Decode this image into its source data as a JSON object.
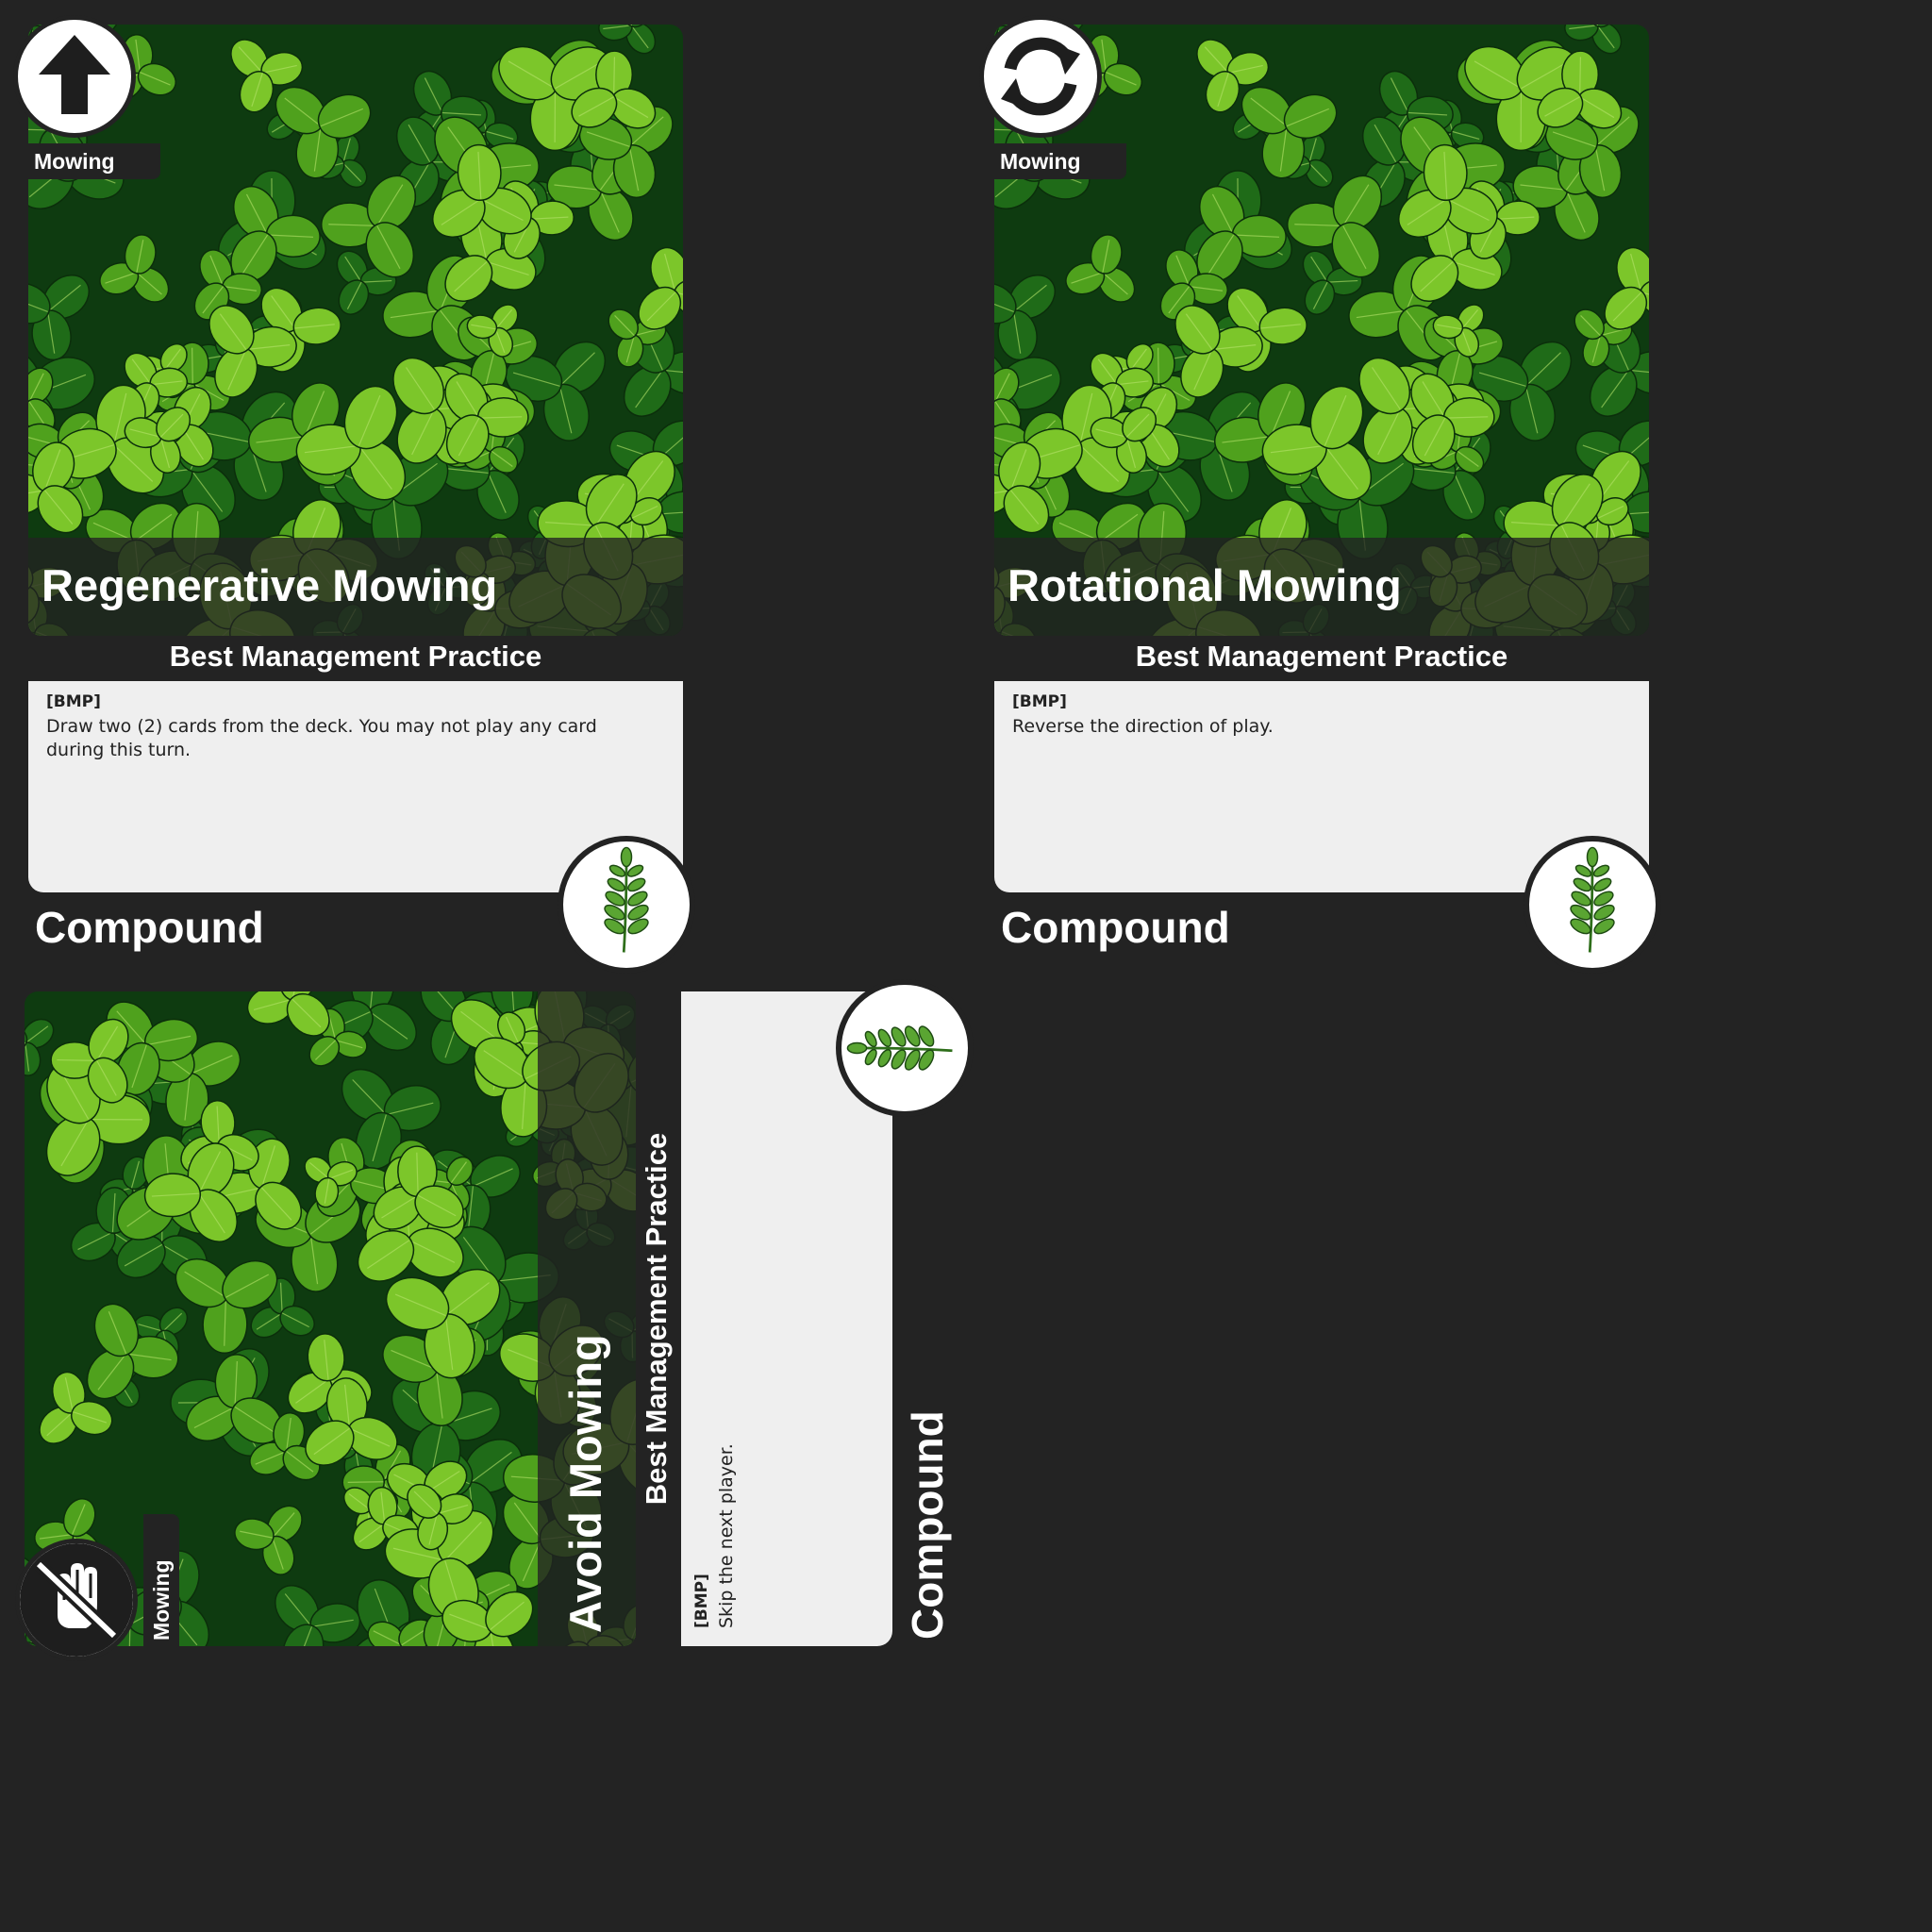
{
  "cards": [
    {
      "title": "Regenerative Mowing",
      "subtitle": "Best Management Practice",
      "category": "Mowing",
      "tag": "[BMP]",
      "body": "Draw two (2) cards from the deck. You may not play any card during this turn.",
      "footer": "Compound",
      "icon": "arrow-up-icon",
      "badge_icon": "leaf-sprig-icon"
    },
    {
      "title": "Rotational Mowing",
      "subtitle": "Best Management Practice",
      "category": "Mowing",
      "tag": "[BMP]",
      "body": "Reverse the direction of play.",
      "footer": "Compound",
      "icon": "reverse-arrows-icon",
      "badge_icon": "leaf-sprig-icon"
    },
    {
      "title": "Avoid Mowing",
      "subtitle": "Best Management Practice",
      "category": "Mowing",
      "tag": "[BMP]",
      "body": "Skip the next player.",
      "footer": "Compound",
      "icon": "no-hand-icon",
      "badge_icon": "leaf-sprig-icon"
    }
  ],
  "colors": {
    "background": "#232323",
    "textbox": "#efefef",
    "clover_light": "#7cc62a",
    "clover_mid": "#4fa11d",
    "clover_dark": "#0e3b10"
  }
}
